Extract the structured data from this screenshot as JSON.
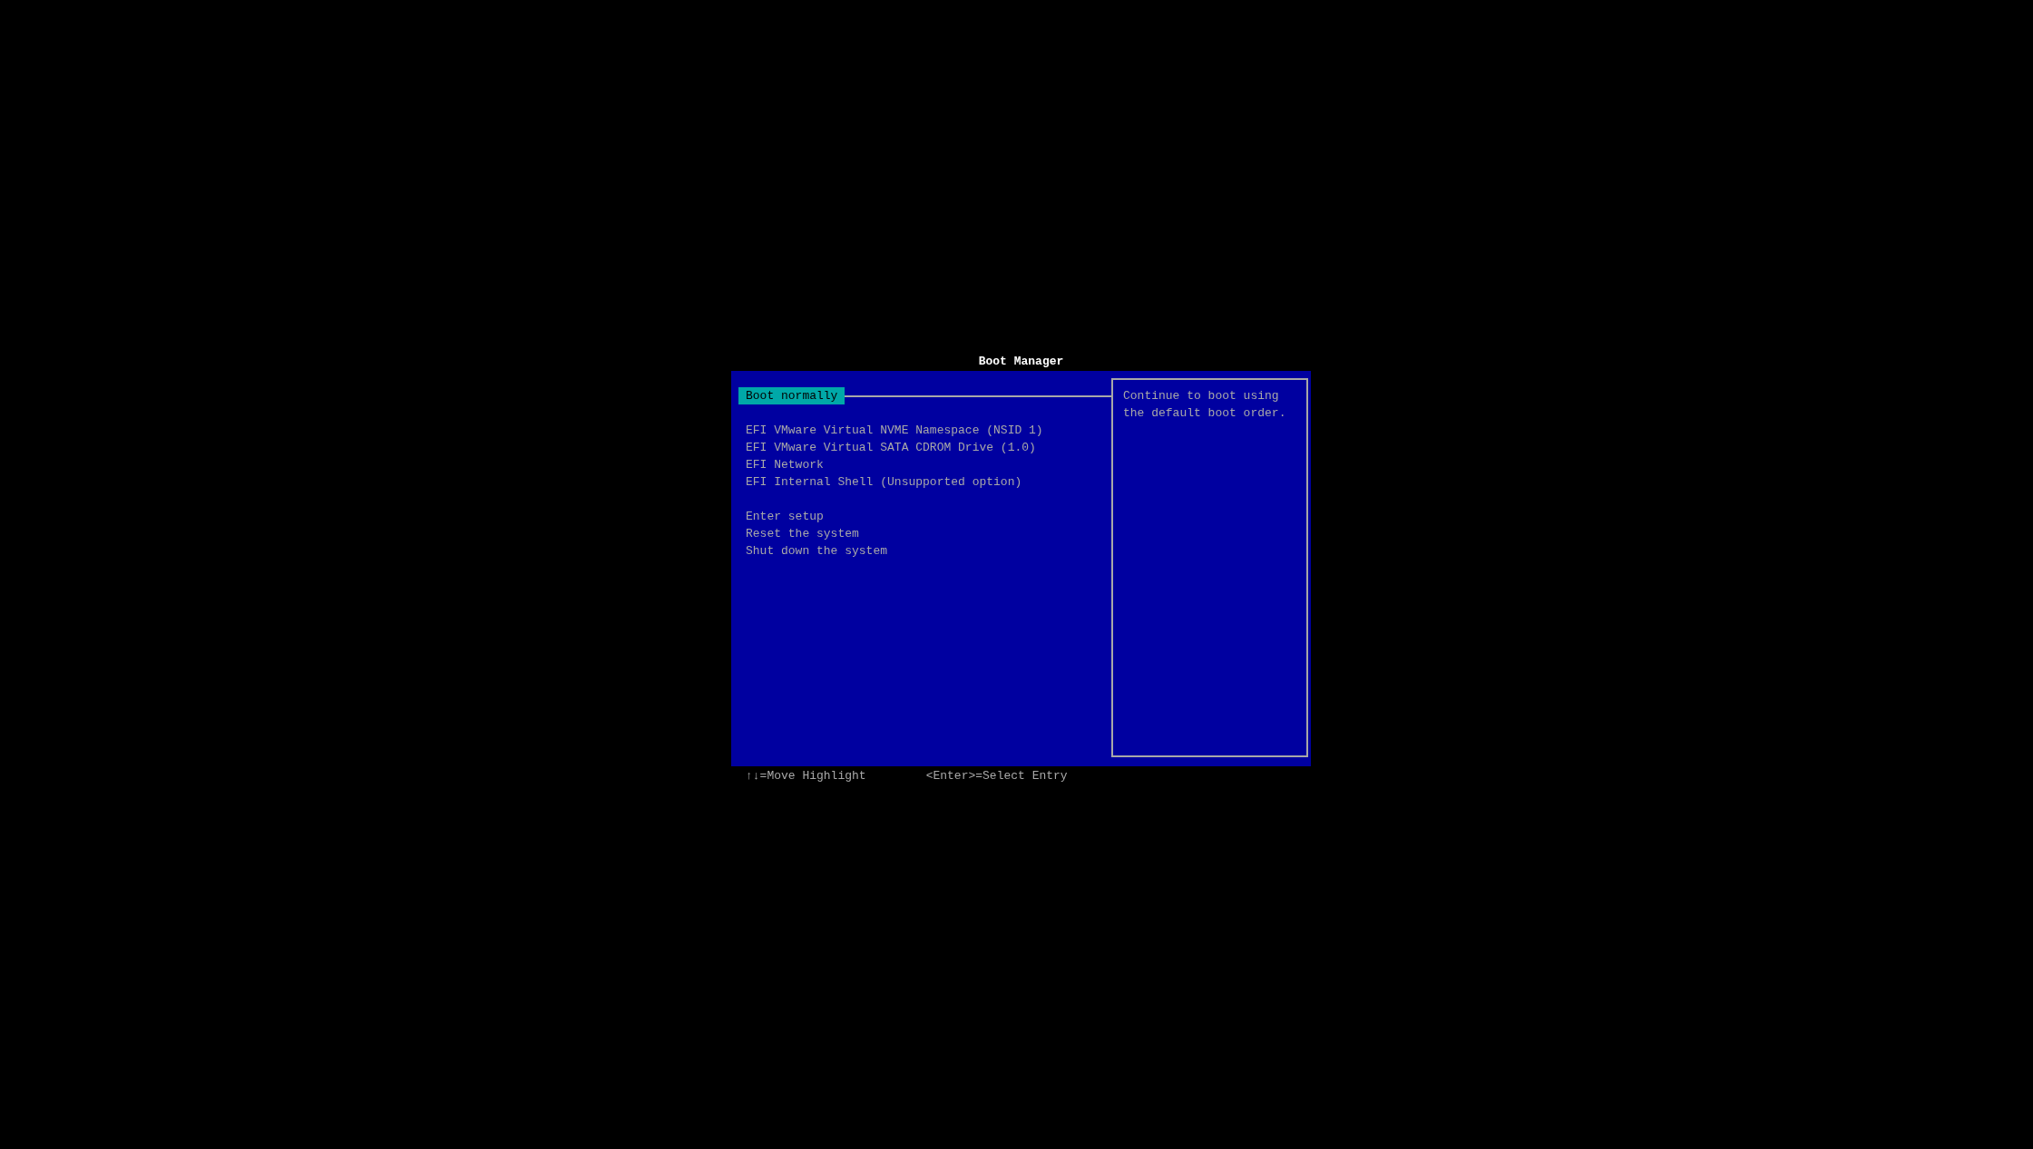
{
  "title": "Boot Manager",
  "menu_groups": [
    [
      {
        "label": "Boot normally",
        "selected": true
      }
    ],
    [
      {
        "label": "EFI VMware Virtual NVME Namespace (NSID 1)",
        "selected": false
      },
      {
        "label": "EFI VMware Virtual SATA CDROM Drive (1.0)",
        "selected": false
      },
      {
        "label": "EFI Network",
        "selected": false
      },
      {
        "label": "EFI Internal Shell (Unsupported option)",
        "selected": false
      }
    ],
    [
      {
        "label": "Enter setup",
        "selected": false
      },
      {
        "label": "Reset the system",
        "selected": false
      },
      {
        "label": "Shut down the system",
        "selected": false
      }
    ]
  ],
  "help_text": "Continue to boot using the default boot order.",
  "key_hints": [
    "↑↓=Move Highlight",
    "<Enter>=Select Entry"
  ]
}
